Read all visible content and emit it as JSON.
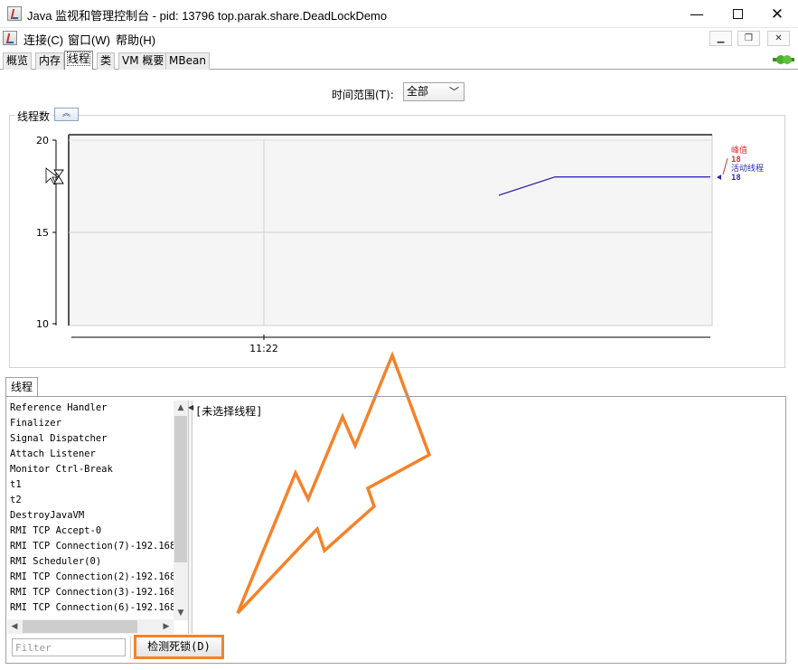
{
  "window": {
    "title": "Java 监视和管理控制台 - pid: 13796 top.parak.share.DeadLockDemo",
    "minimize": "—",
    "close": "✕"
  },
  "menu": {
    "items": [
      "连接(C)",
      "窗口(W)",
      "帮助(H)"
    ],
    "mdi_minimize": "▁",
    "mdi_restore": "❐",
    "mdi_close": "✕"
  },
  "tabs": [
    {
      "label": "概览",
      "active": false
    },
    {
      "label": "内存",
      "active": false
    },
    {
      "label": "线程",
      "active": true
    },
    {
      "label": "类",
      "active": false
    },
    {
      "label": "VM 概要",
      "active": false
    },
    {
      "label": "MBean",
      "active": false
    }
  ],
  "time_range": {
    "label": "时间范围(T):",
    "selected": "全部"
  },
  "thread_count_panel": {
    "title": "线程数",
    "collapse_icon": "collapse-up-icon"
  },
  "chart_data": {
    "type": "line",
    "title": "",
    "xlabel": "",
    "ylabel": "",
    "y_ticks": [
      "20",
      "15",
      "10"
    ],
    "ylim": [
      10,
      20
    ],
    "x_ticks": [
      "11:22"
    ],
    "grid": true,
    "legend_position": "right",
    "series": [
      {
        "name": "峰值",
        "value_label": "18",
        "color": "#e03030",
        "points": [
          [
            0,
            17
          ],
          [
            0.08,
            18
          ],
          [
            0.3,
            18
          ]
        ]
      },
      {
        "name": "活动线程",
        "value_label": "18",
        "color": "#2b2bb8",
        "points": [
          [
            0,
            17
          ],
          [
            0.08,
            18
          ],
          [
            0.3,
            18
          ]
        ]
      }
    ]
  },
  "threads": {
    "tab_label": "线程",
    "items": [
      "Reference Handler",
      "Finalizer",
      "Signal Dispatcher",
      "Attach Listener",
      "Monitor Ctrl-Break",
      "t1",
      "t2",
      "DestroyJavaVM",
      "RMI TCP Accept-0",
      "RMI TCP Connection(7)-192.168.",
      "RMI Scheduler(0)",
      "RMI TCP Connection(2)-192.168.",
      "RMI TCP Connection(3)-192.168.",
      "RMI TCP Connection(6)-192.168."
    ],
    "detail_text": "[未选择线程]",
    "filter_placeholder": "Filter",
    "detect_button": "检测死锁(D)"
  },
  "colors": {
    "accent_orange": "#f5822a",
    "peak": "#e03030",
    "live": "#2b2bb8"
  }
}
